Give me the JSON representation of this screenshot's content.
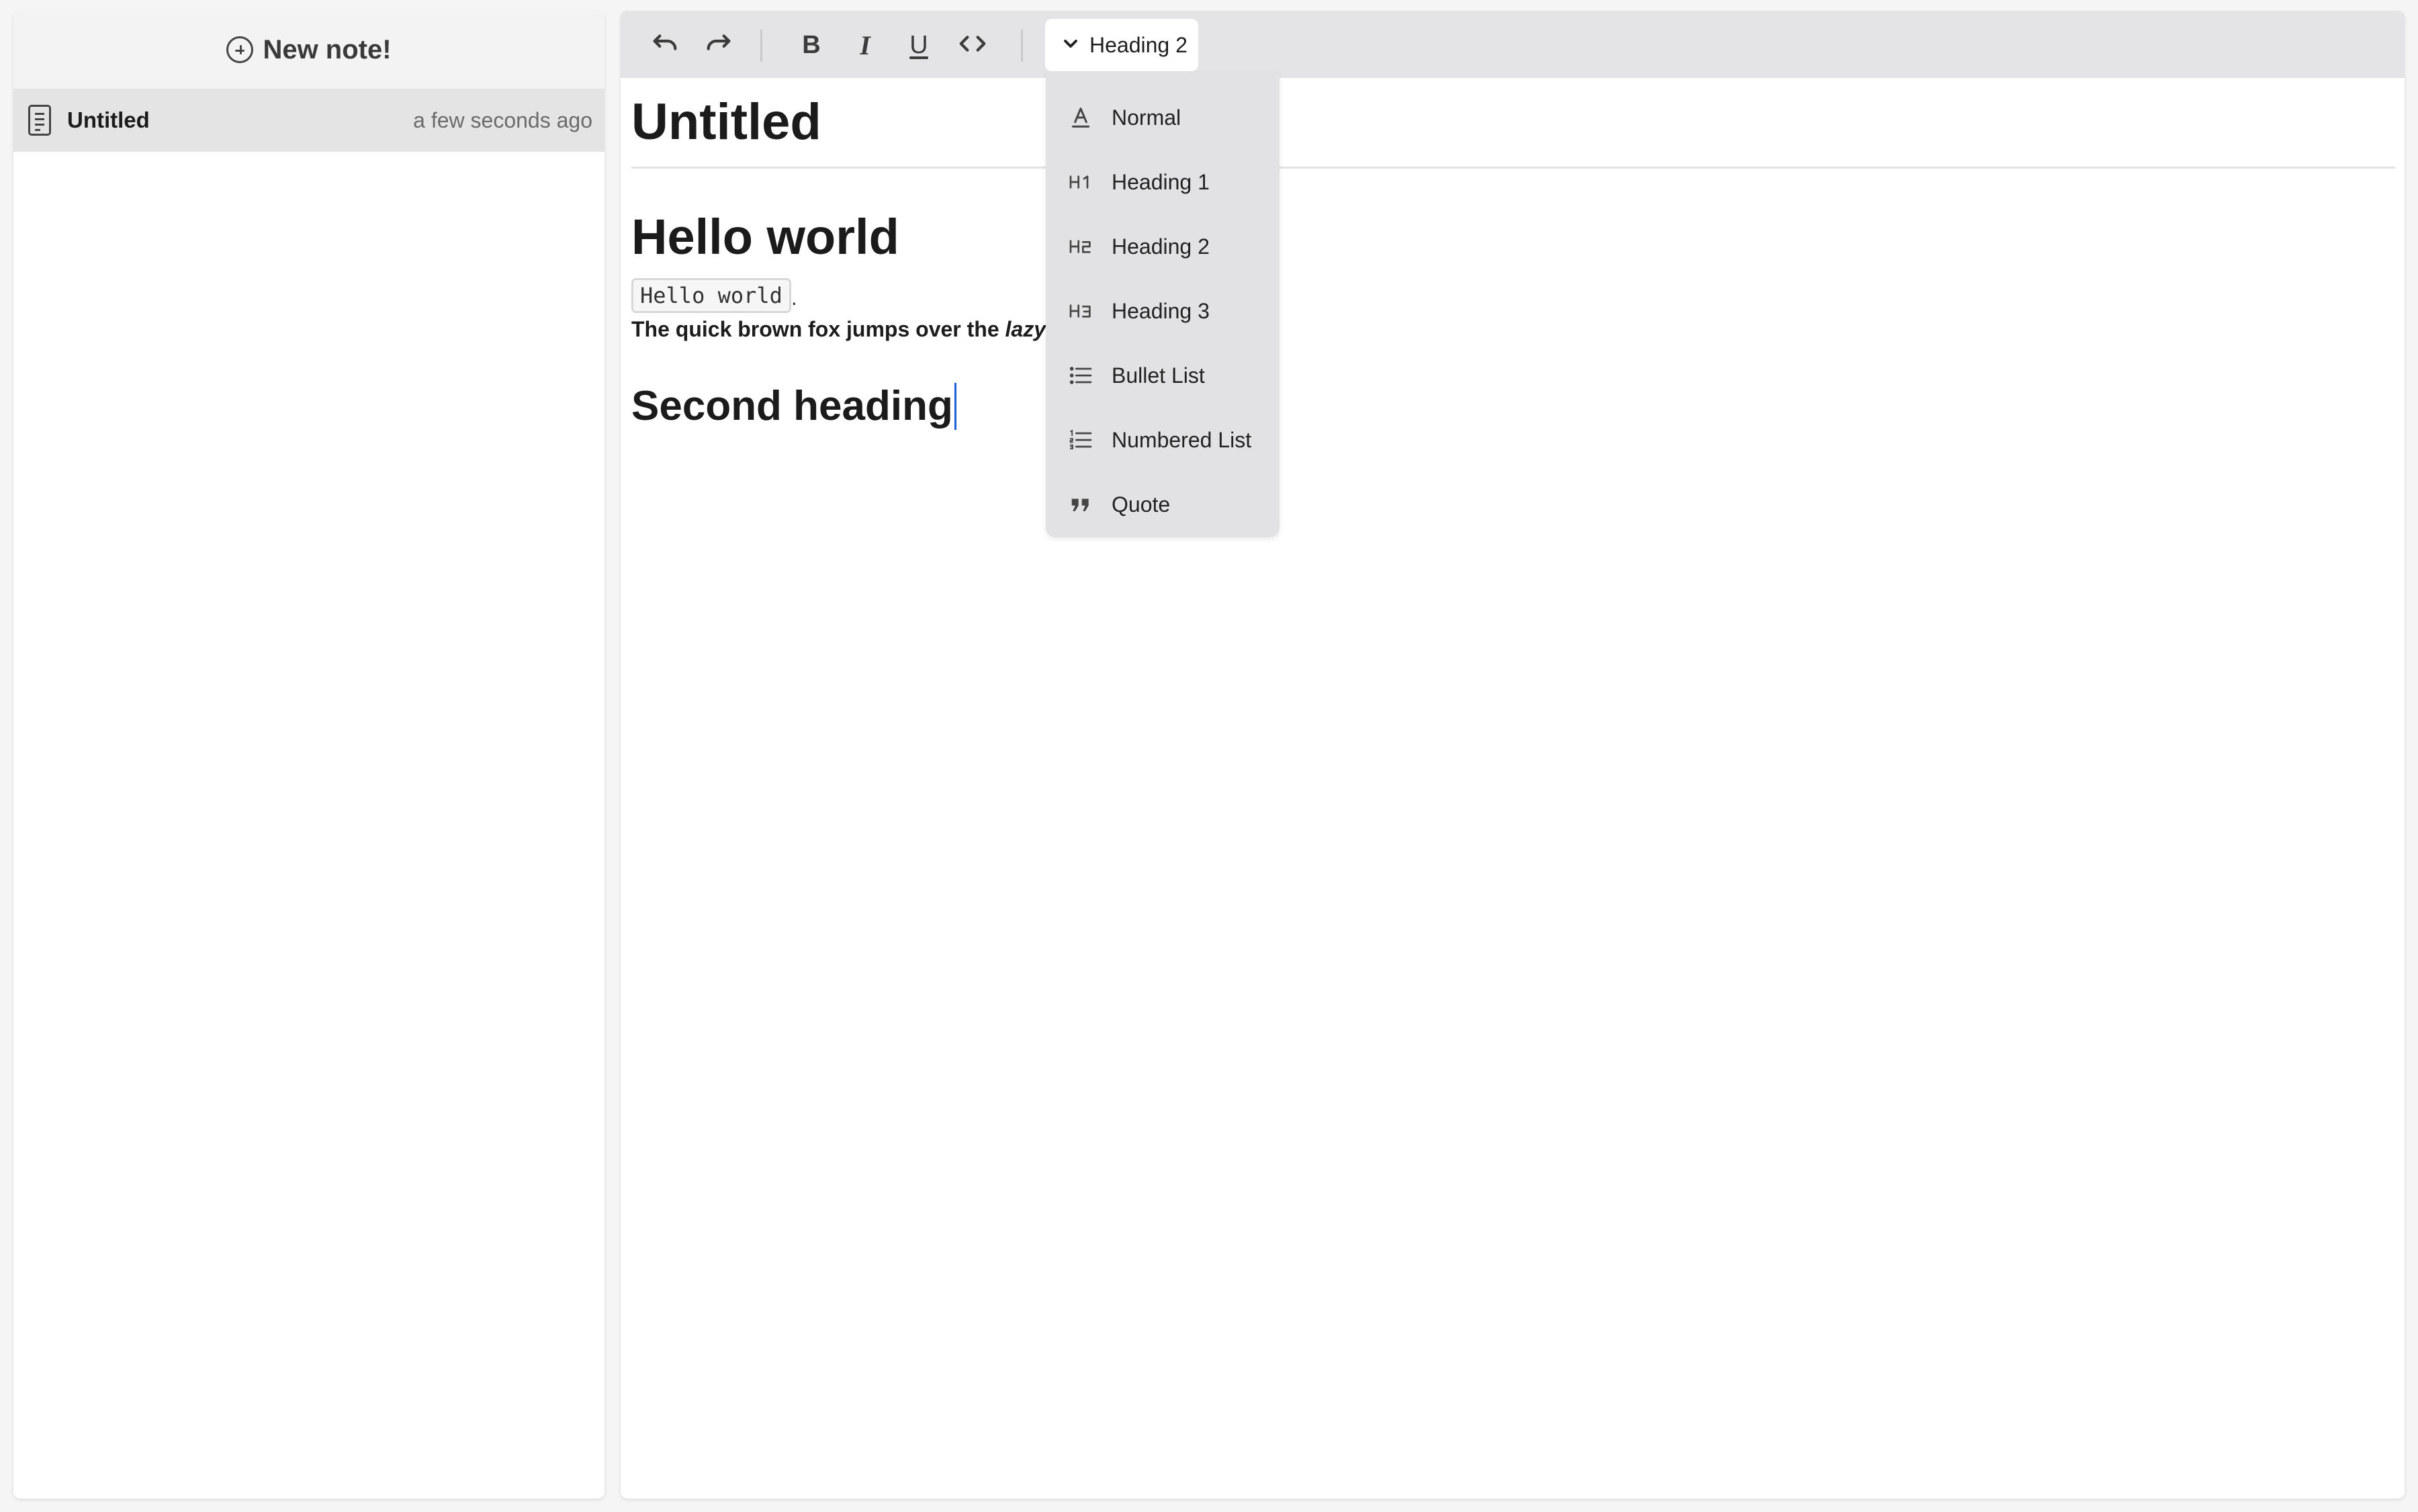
{
  "sidebar": {
    "new_note_label": "New note!",
    "notes": [
      {
        "title": "Untitled",
        "time": "a few seconds ago"
      }
    ]
  },
  "toolbar": {
    "buttons": [
      "undo-icon",
      "redo-icon",
      "bold-icon",
      "italic-icon",
      "underline-icon",
      "code-icon"
    ],
    "bold_glyph": "B",
    "italic_glyph": "I",
    "underline_glyph": "U",
    "block_type": "Heading 2"
  },
  "editor": {
    "title": "Untitled",
    "heading1": "Hello world",
    "inline_code": "Hello world",
    "inline_code_suffix": ".",
    "paragraph_bold": "The quick brown fox jumps over the ",
    "paragraph_italic": "lazy",
    "heading2": "Second heading"
  },
  "dropdown": {
    "items": [
      {
        "label": "Normal",
        "icon": "text-normal-icon"
      },
      {
        "label": "Heading 1",
        "icon": "h1-icon"
      },
      {
        "label": "Heading 2",
        "icon": "h2-icon"
      },
      {
        "label": "Heading 3",
        "icon": "h3-icon"
      },
      {
        "label": "Bullet List",
        "icon": "bullet-list-icon"
      },
      {
        "label": "Numbered List",
        "icon": "numbered-list-icon"
      },
      {
        "label": "Quote",
        "icon": "quote-icon"
      }
    ]
  },
  "colors": {
    "caret": "#1a5fd6",
    "toolbar_bg": "#e4e4e6",
    "selected_note_bg": "#e4e4e4"
  }
}
